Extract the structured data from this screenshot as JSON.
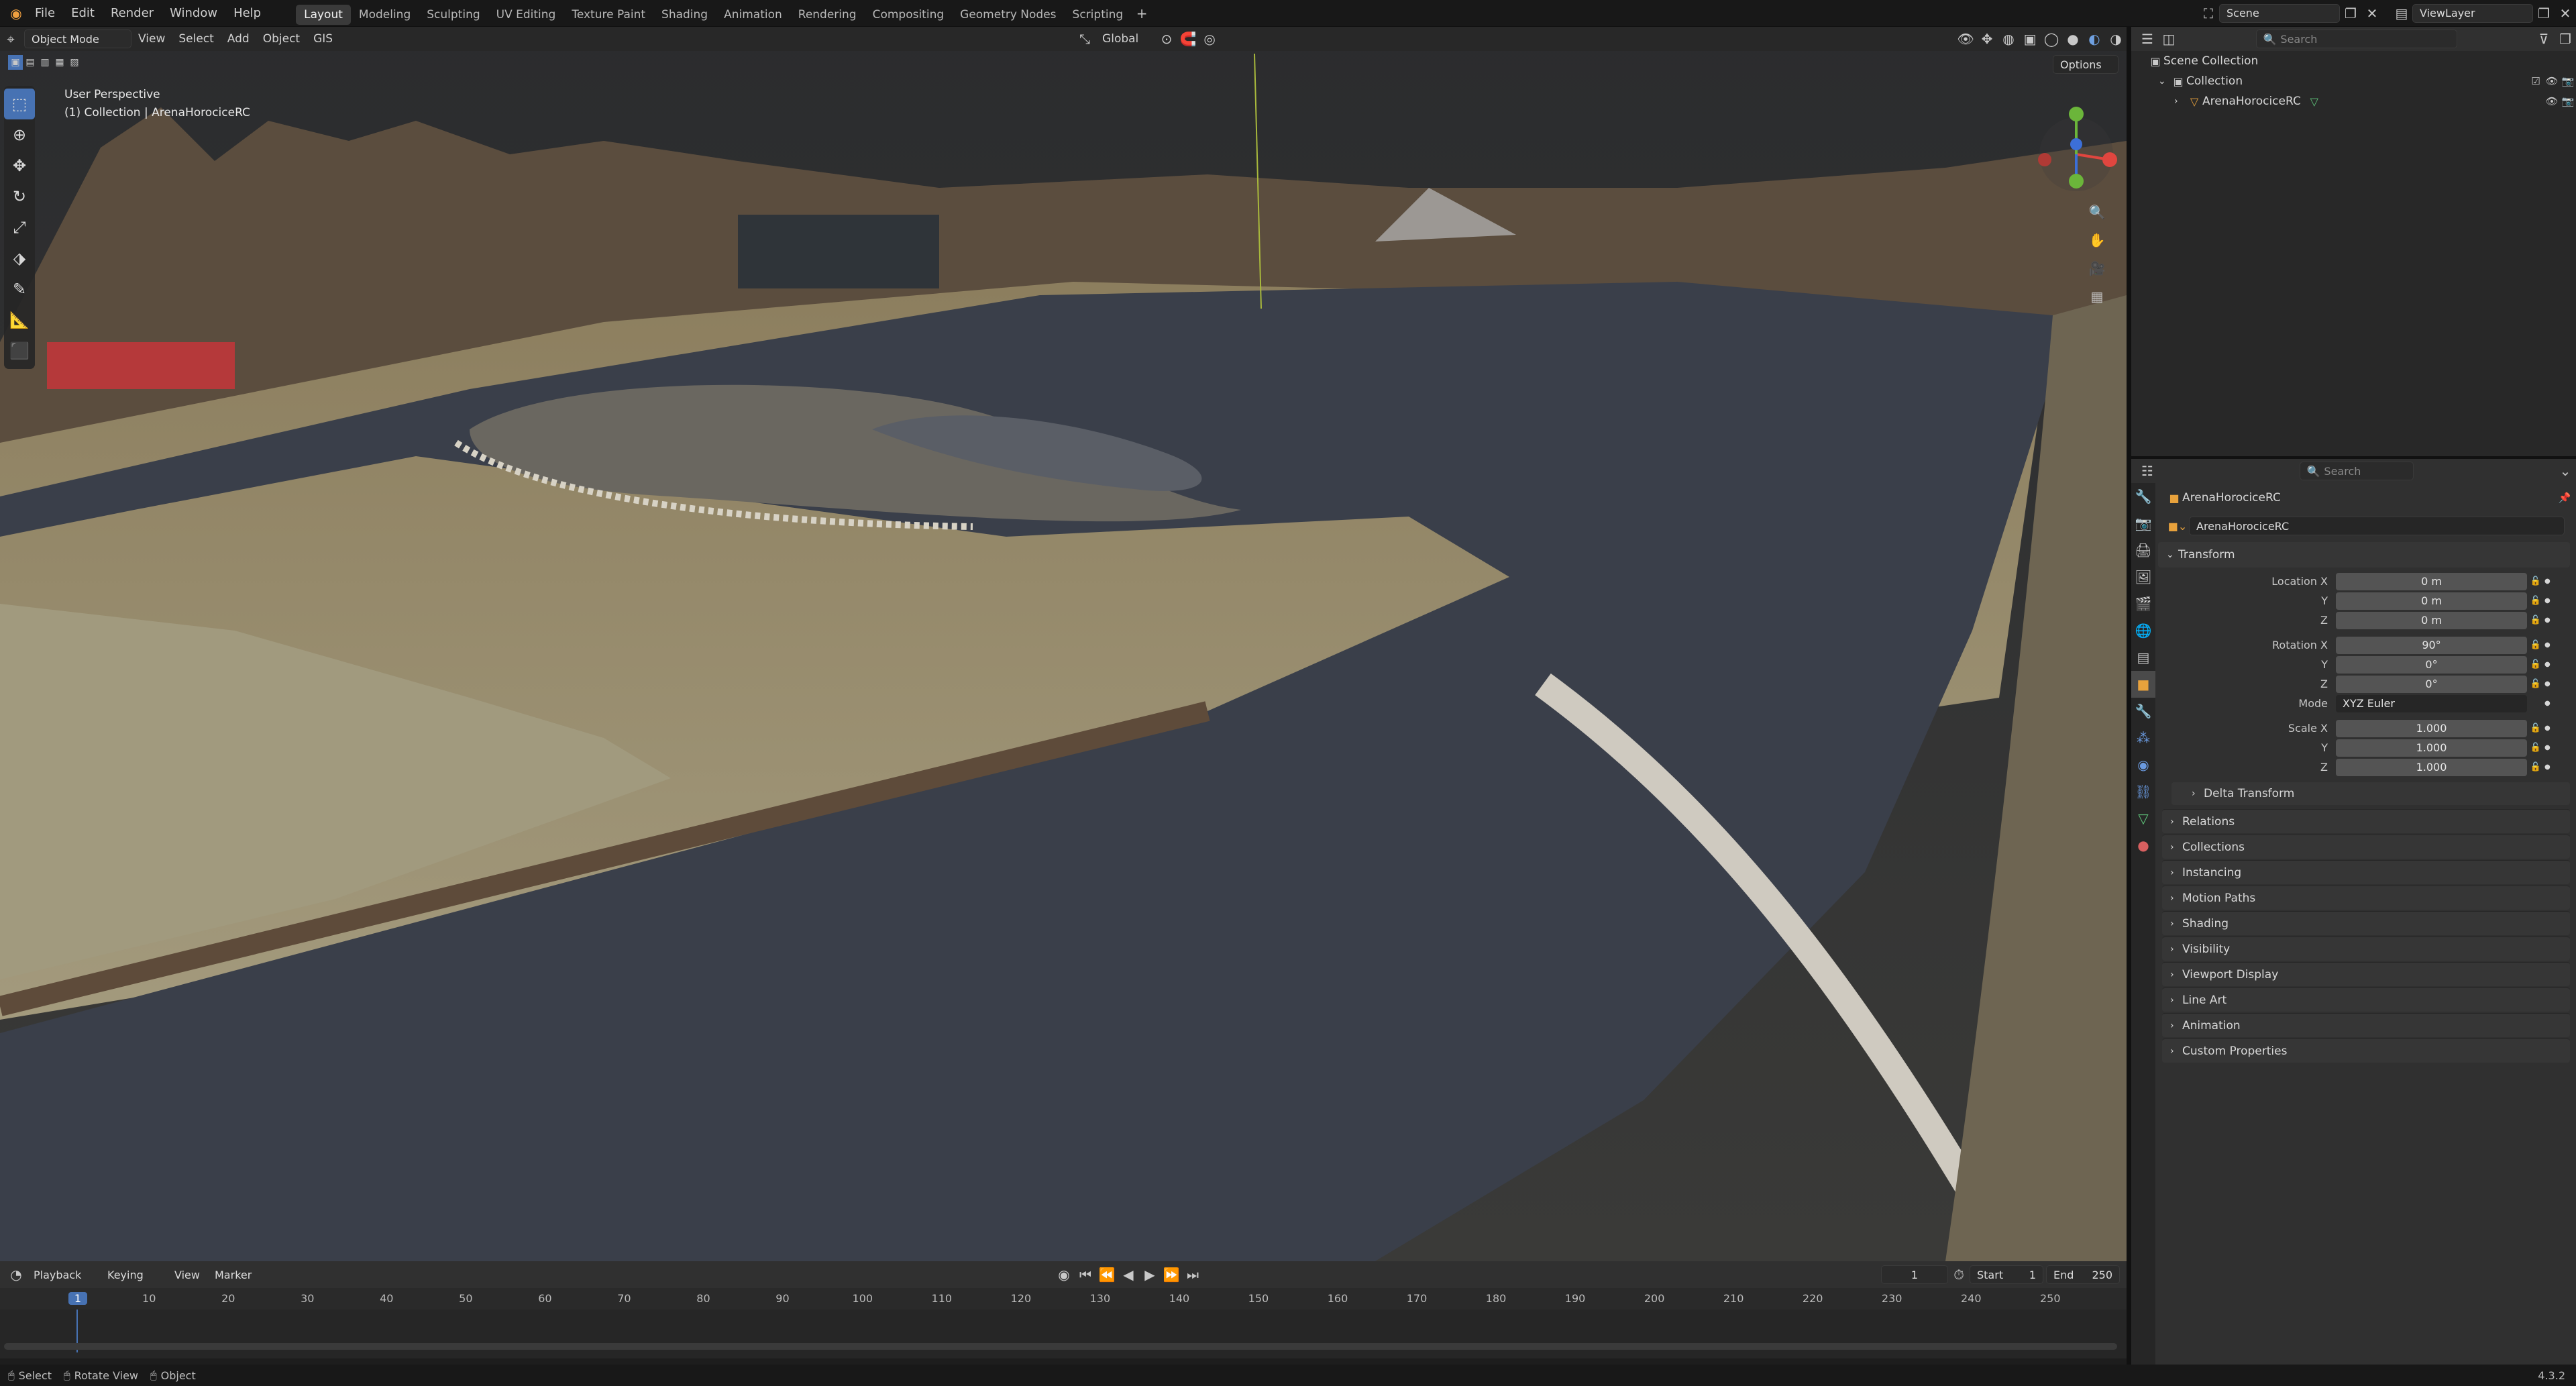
{
  "app": {
    "logo_icon": "blender-logo-icon",
    "version": "4.3.2"
  },
  "menu": [
    "File",
    "Edit",
    "Render",
    "Window",
    "Help"
  ],
  "workspaces": [
    "Layout",
    "Modeling",
    "Sculpting",
    "UV Editing",
    "Texture Paint",
    "Shading",
    "Animation",
    "Rendering",
    "Compositing",
    "Geometry Nodes",
    "Scripting"
  ],
  "active_workspace": "Layout",
  "scene_label": "Scene",
  "viewlayer_label": "ViewLayer",
  "viewport": {
    "mode": "Object Mode",
    "menus": [
      "View",
      "Select",
      "Add",
      "Object",
      "GIS"
    ],
    "transform_orientation": "Global",
    "options_label": "Options",
    "overlay_line1": "User Perspective",
    "overlay_line2": "(1) Collection | ArenaHorociceRC"
  },
  "outliner": {
    "search_placeholder": "Search",
    "scene_collection": "Scene Collection",
    "collection": "Collection",
    "object": "ArenaHorociceRC"
  },
  "properties": {
    "search_placeholder": "Search",
    "object_name": "ArenaHorociceRC",
    "object_datablock": "ArenaHorociceRC",
    "transform_title": "Transform",
    "location": {
      "label_x": "Location X",
      "label_y": "Y",
      "label_z": "Z",
      "x": "0 m",
      "y": "0 m",
      "z": "0 m"
    },
    "rotation": {
      "label_x": "Rotation X",
      "label_y": "Y",
      "label_z": "Z",
      "x": "90°",
      "y": "0°",
      "z": "0°"
    },
    "mode": {
      "label": "Mode",
      "value": "XYZ Euler"
    },
    "scale": {
      "label_x": "Scale X",
      "label_y": "Y",
      "label_z": "Z",
      "x": "1.000",
      "y": "1.000",
      "z": "1.000"
    },
    "delta_transform": "Delta Transform",
    "panels": [
      "Relations",
      "Collections",
      "Instancing",
      "Motion Paths",
      "Shading",
      "Visibility",
      "Viewport Display",
      "Line Art",
      "Animation",
      "Custom Properties"
    ]
  },
  "timeline": {
    "menus": [
      "Playback",
      "Keying",
      "View",
      "Marker"
    ],
    "current_frame": "1",
    "start_label": "Start",
    "start": "1",
    "end_label": "End",
    "end": "250",
    "ruler": [
      "1",
      "10",
      "20",
      "30",
      "40",
      "50",
      "60",
      "70",
      "80",
      "90",
      "100",
      "110",
      "120",
      "130",
      "140",
      "150",
      "160",
      "170",
      "180",
      "190",
      "200",
      "210",
      "220",
      "230",
      "240",
      "250"
    ]
  },
  "statusbar": {
    "items": [
      "Select",
      "Rotate View",
      "Object"
    ]
  },
  "colors": {
    "accent": "#4772b3",
    "track": "#3a3f4a",
    "grass": "#8a7a55"
  }
}
